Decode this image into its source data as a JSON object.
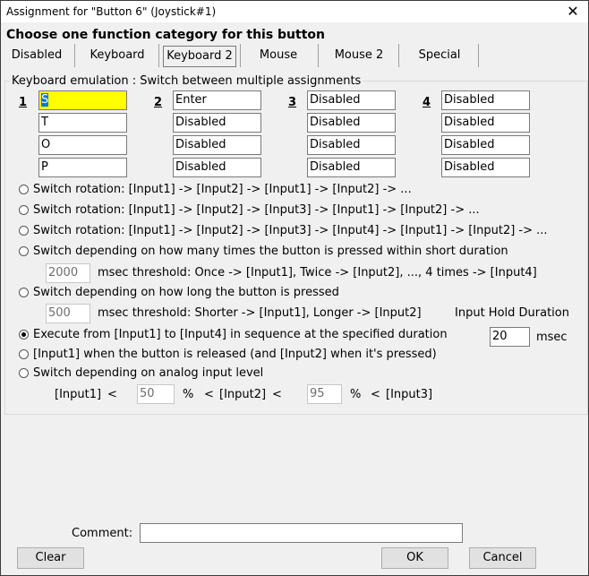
{
  "window": {
    "title": "Assignment for \"Button 6\" (Joystick#1)"
  },
  "heading": "Choose one function category for this button",
  "tabs": [
    "Disabled",
    "Keyboard",
    "Keyboard 2",
    "Mouse",
    "Mouse 2",
    "Special"
  ],
  "selected_tab": "Keyboard 2",
  "group_label": "Keyboard emulation : Switch between multiple assignments",
  "columns": [
    {
      "num": "1",
      "values": [
        "S",
        "T",
        "O",
        "P"
      ]
    },
    {
      "num": "2",
      "values": [
        "Enter",
        "Disabled",
        "Disabled",
        "Disabled"
      ]
    },
    {
      "num": "3",
      "values": [
        "Disabled",
        "Disabled",
        "Disabled",
        "Disabled"
      ]
    },
    {
      "num": "4",
      "values": [
        "Disabled",
        "Disabled",
        "Disabled",
        "Disabled"
      ]
    }
  ],
  "options": [
    "Switch rotation: [Input1] -> [Input2] -> [Input1] -> [Input2] -> ...",
    "Switch rotation: [Input1] -> [Input2] -> [Input3] -> [Input1] -> [Input2] -> ...",
    "Switch rotation: [Input1] -> [Input2] -> [Input3] -> [Input4] -> [Input1] -> [Input2] -> ...",
    "Switch depending on how many times the button is pressed within short duration",
    "Switch depending on how long the button is pressed",
    "Execute from [Input1] to [Input4] in sequence at the specified duration",
    "[Input1] when the button is released (and [Input2] when it's pressed)",
    "Switch depending on analog input level"
  ],
  "selected_option": 5,
  "short_press": {
    "value": "2000",
    "text": "msec threshold: Once -> [Input1], Twice -> [Input2], ..., 4 times -> [Input4]"
  },
  "long_press": {
    "value": "500",
    "text": "msec threshold: Shorter -> [Input1], Longer -> [Input2]"
  },
  "hold": {
    "label": "Input Hold Duration",
    "value": "20",
    "unit": "msec"
  },
  "analog": {
    "input1": "[Input1]",
    "lt1": "<",
    "value1": "50",
    "pct1": "%",
    "lt2": "<",
    "input2": "[Input2]",
    "lt3": "<",
    "value2": "95",
    "pct2": "%",
    "lt4": "<",
    "input3": "[Input3]"
  },
  "comment": {
    "label": "Comment:",
    "value": ""
  },
  "buttons": {
    "clear": "Clear",
    "ok": "OK",
    "cancel": "Cancel"
  }
}
